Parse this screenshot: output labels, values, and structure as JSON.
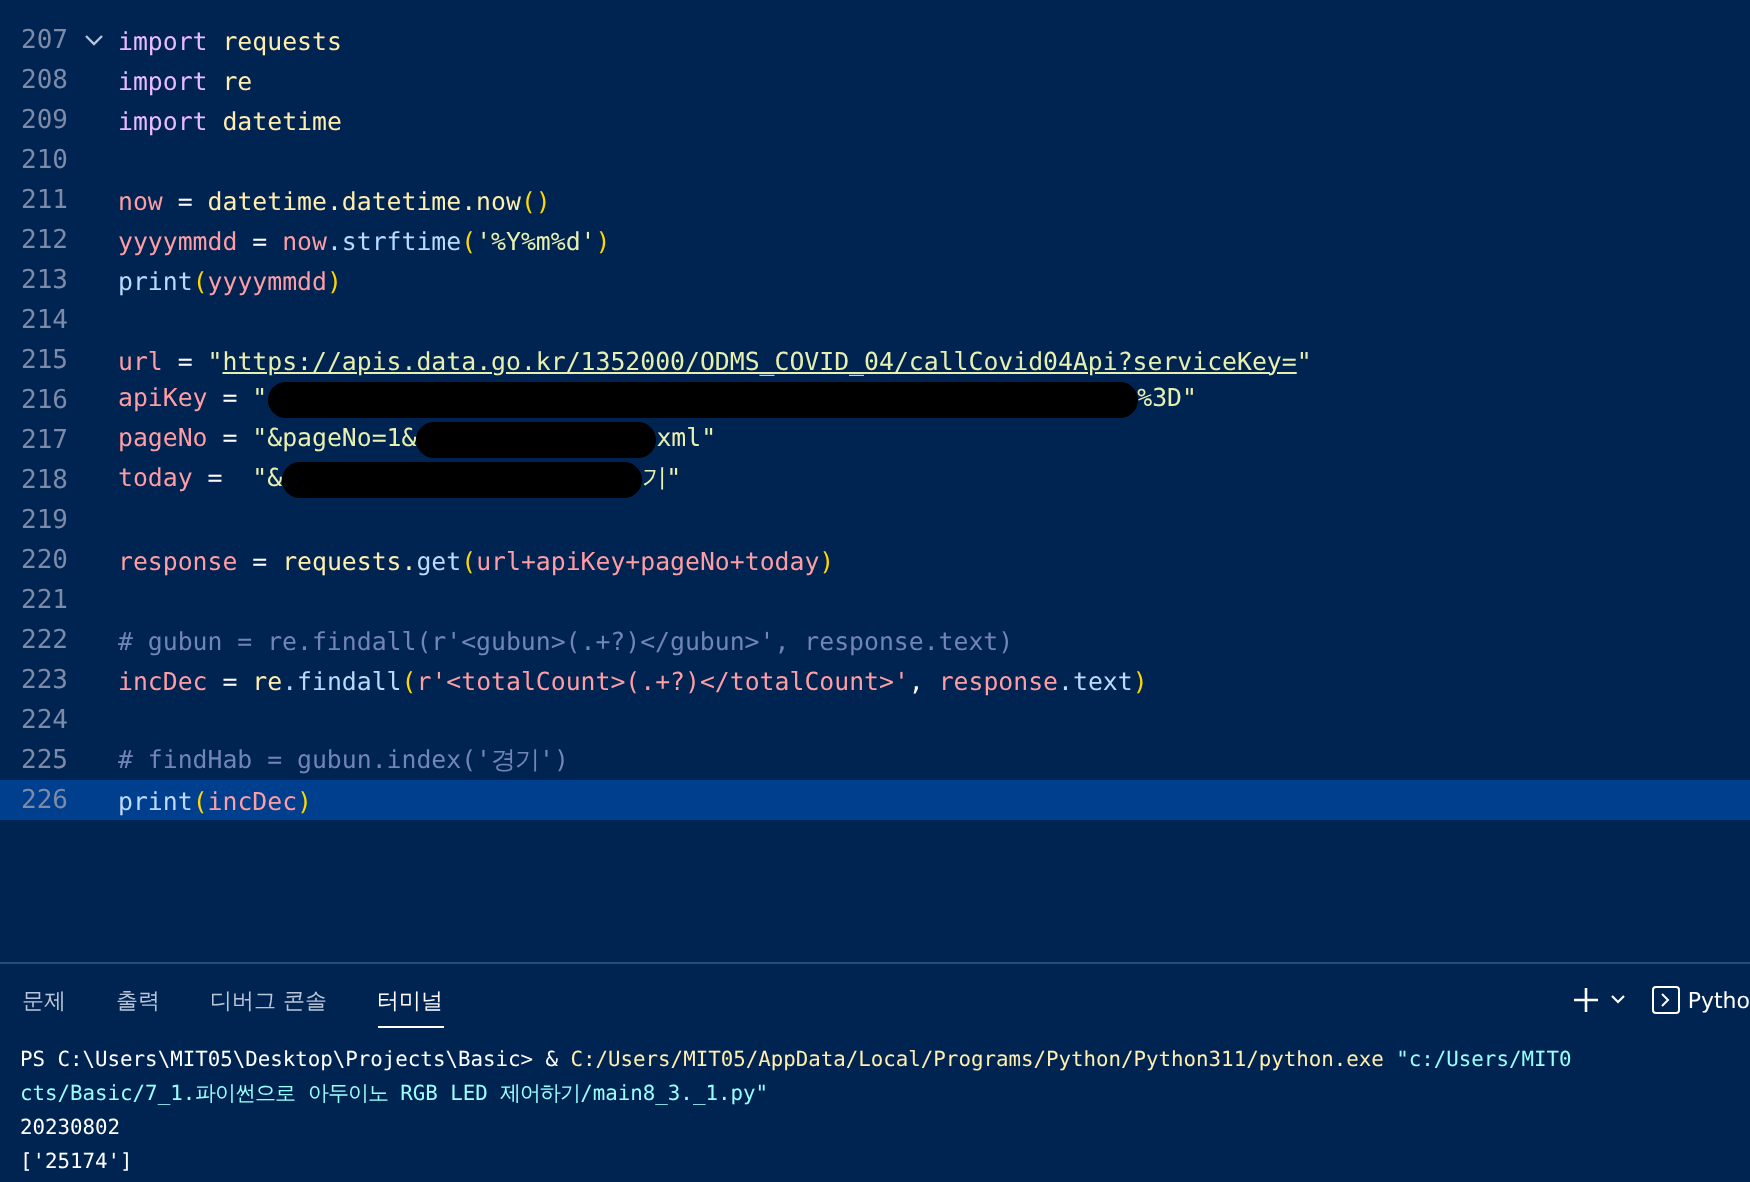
{
  "editor": {
    "lines": [
      {
        "number": "207",
        "selected": false,
        "foldable": true,
        "tokens": [
          {
            "t": "import",
            "kind": "kw"
          },
          {
            "t": " requests",
            "kind": "mod"
          }
        ]
      },
      {
        "number": "208",
        "selected": false,
        "tokens": [
          {
            "t": "import",
            "kind": "kw"
          },
          {
            "t": " re",
            "kind": "mod"
          }
        ]
      },
      {
        "number": "209",
        "selected": false,
        "tokens": [
          {
            "t": "import",
            "kind": "kw"
          },
          {
            "t": " datetime",
            "kind": "mod"
          }
        ]
      },
      {
        "number": "210",
        "selected": false
      },
      {
        "number": "211",
        "selected": false,
        "tokens": [
          {
            "t": "now",
            "kind": "var"
          },
          {
            "t": " = ",
            "kind": "op"
          },
          {
            "t": "datetime.datetime.now",
            "kind": "mod"
          },
          {
            "t": "()",
            "kind": "paren"
          }
        ]
      },
      {
        "number": "212",
        "selected": false,
        "tokens": [
          {
            "t": "yyyymmdd",
            "kind": "var"
          },
          {
            "t": " = ",
            "kind": "op"
          },
          {
            "t": "now",
            "kind": "var"
          },
          {
            "t": ".strftime",
            "kind": "fn"
          },
          {
            "t": "(",
            "kind": "paren"
          },
          {
            "t": "'%Y%m%d'",
            "kind": "str"
          },
          {
            "t": ")",
            "kind": "paren"
          }
        ]
      },
      {
        "number": "213",
        "selected": false,
        "tokens": [
          {
            "t": "print",
            "kind": "fn"
          },
          {
            "t": "(",
            "kind": "paren"
          },
          {
            "t": "yyyymmdd",
            "kind": "var"
          },
          {
            "t": ")",
            "kind": "paren"
          }
        ]
      },
      {
        "number": "214",
        "selected": false
      },
      {
        "number": "215",
        "selected": false,
        "tokens": [
          {
            "t": "url",
            "kind": "var"
          },
          {
            "t": " = ",
            "kind": "op"
          },
          {
            "t": "\"",
            "kind": "str"
          },
          {
            "t": "https://apis.data.go.kr/1352000/ODMS_COVID_04/callCovid04Api?serviceKey=",
            "kind": "link"
          },
          {
            "t": "\"",
            "kind": "str"
          }
        ]
      },
      {
        "number": "216",
        "selected": false,
        "tokens": [
          {
            "t": "apiKey",
            "kind": "var"
          },
          {
            "t": " = ",
            "kind": "op"
          },
          {
            "t": "\"",
            "kind": "str"
          },
          {
            "kind": "redacted"
          },
          {
            "t": "%3D\"",
            "kind": "str"
          }
        ]
      },
      {
        "number": "217",
        "selected": false,
        "tokens": [
          {
            "t": "pageNo",
            "kind": "var"
          },
          {
            "t": " = ",
            "kind": "op"
          },
          {
            "t": "\"&pageNo=1&",
            "kind": "str"
          },
          {
            "kind": "redacted"
          },
          {
            "t": "xml\"",
            "kind": "str"
          }
        ]
      },
      {
        "number": "218",
        "selected": false,
        "tokens": [
          {
            "t": "today",
            "kind": "var"
          },
          {
            "t": " =  ",
            "kind": "op"
          },
          {
            "t": "\"&",
            "kind": "str"
          },
          {
            "kind": "redacted"
          },
          {
            "t": "기\"",
            "kind": "str"
          }
        ]
      },
      {
        "number": "219",
        "selected": false
      },
      {
        "number": "220",
        "selected": false,
        "tokens": [
          {
            "t": "response",
            "kind": "var"
          },
          {
            "t": " = ",
            "kind": "op"
          },
          {
            "t": "requests.",
            "kind": "mod"
          },
          {
            "t": "get",
            "kind": "fn"
          },
          {
            "t": "(",
            "kind": "paren"
          },
          {
            "t": "url+apiKey+pageNo+today",
            "kind": "var"
          },
          {
            "t": ")",
            "kind": "paren"
          }
        ]
      },
      {
        "number": "221",
        "selected": false
      },
      {
        "number": "222",
        "selected": false,
        "tokens": [
          {
            "t": "# gubun = re.findall(r'<gubun>(.+?)</gubun>', response.text)",
            "kind": "comment"
          }
        ]
      },
      {
        "number": "223",
        "selected": false,
        "tokens": [
          {
            "t": "incDec",
            "kind": "var"
          },
          {
            "t": " = ",
            "kind": "op"
          },
          {
            "t": "re",
            "kind": "mod"
          },
          {
            "t": ".findall",
            "kind": "fn"
          },
          {
            "t": "(",
            "kind": "paren"
          },
          {
            "t": "r'<totalCount>(.+?)</totalCount>'",
            "kind": "var"
          },
          {
            "t": ", ",
            "kind": "op"
          },
          {
            "t": "response",
            "kind": "var"
          },
          {
            "t": ".text",
            "kind": "fn"
          },
          {
            "t": ")",
            "kind": "paren"
          }
        ]
      },
      {
        "number": "224",
        "selected": false
      },
      {
        "number": "225",
        "selected": false,
        "tokens": [
          {
            "t": "# findHab = gubun.index('경기')",
            "kind": "comment"
          }
        ]
      },
      {
        "number": "226",
        "selected": true,
        "tokens": [
          {
            "t": "print",
            "kind": "fn"
          },
          {
            "t": "(",
            "kind": "paren"
          },
          {
            "t": "incDec",
            "kind": "var"
          },
          {
            "t": ")",
            "kind": "paren"
          }
        ]
      }
    ]
  },
  "panel": {
    "tabs": [
      {
        "label": "문제",
        "selected": false
      },
      {
        "label": "출력",
        "selected": false
      },
      {
        "label": "디버그 콘솔",
        "selected": false
      },
      {
        "label": "터미널",
        "selected": true
      }
    ],
    "profile": "Pytho",
    "terminal": [
      [
        {
          "t": "PS C:\\Users\\MIT05\\Desktop\\Projects\\Basic> & ",
          "kind": "plain"
        },
        {
          "t": "C:/Users/MIT05/AppData/Local/Programs/Python/Python311/python.exe",
          "kind": "path"
        },
        {
          "t": " \"c:/Users/MIT0",
          "kind": "arg"
        }
      ],
      [
        {
          "t": "cts/Basic/7_1.파이썬으로 아두이노 RGB LED 제어하기/main8_3._1.py\"",
          "kind": "arg"
        }
      ],
      [
        {
          "t": "20230802",
          "kind": "plain"
        }
      ],
      [
        {
          "t": "['25174']",
          "kind": "plain"
        }
      ]
    ]
  }
}
